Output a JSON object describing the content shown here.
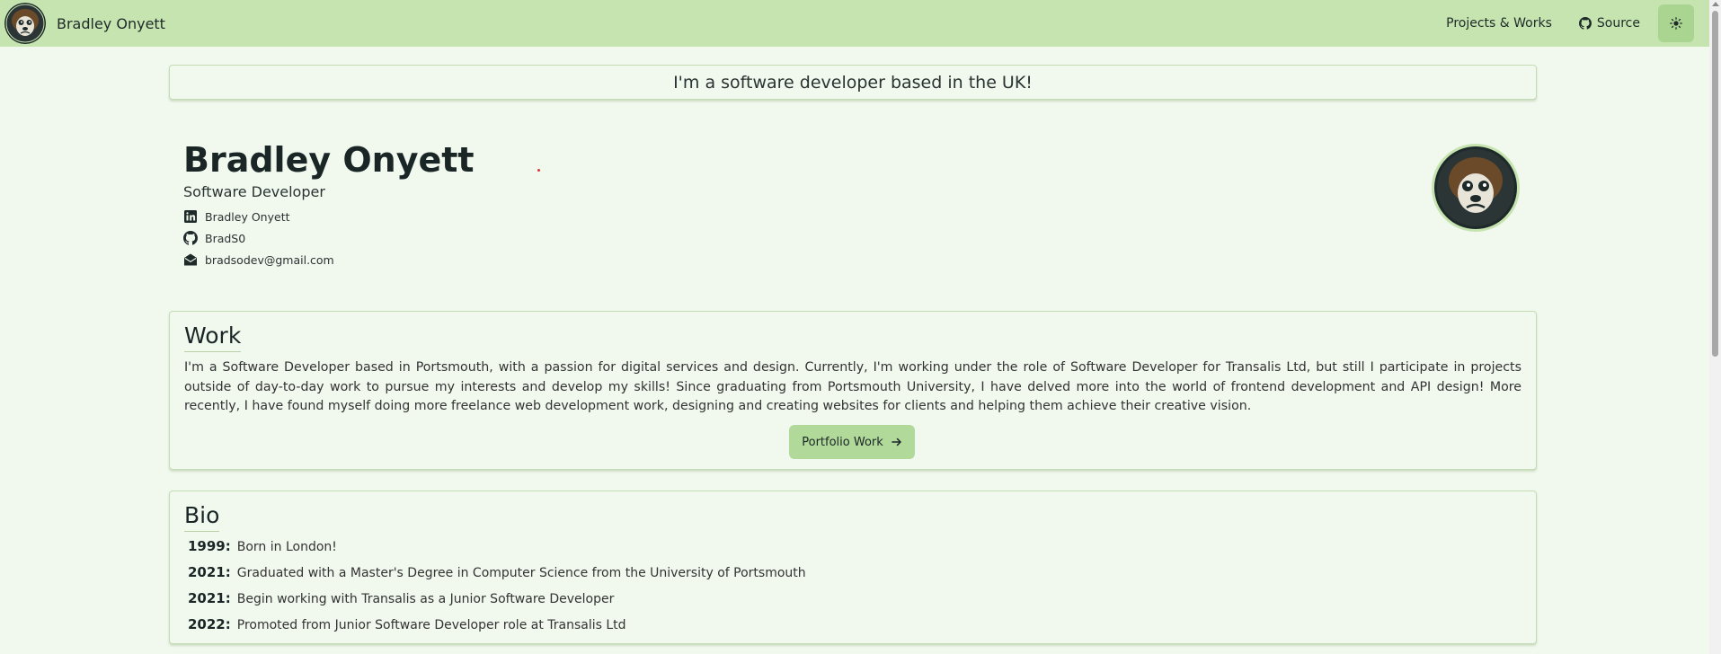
{
  "navbar": {
    "brand": "Bradley Onyett",
    "projects_label": "Projects & Works",
    "source_label": "Source",
    "theme_icon": "sun-icon"
  },
  "tagline": "I'm a software developer based in the UK!",
  "profile": {
    "name": "Bradley Onyett",
    "role": "Software Developer",
    "linkedin": "Bradley Onyett",
    "github": "BradS0",
    "email": "bradsodev@gmail.com"
  },
  "work": {
    "title": "Work",
    "text": "I'm a Software Developer based in Portsmouth, with a passion for digital services and design. Currently, I'm working under the role of Software Developer for Transalis Ltd, but still I participate in projects outside of day-to-day work to pursue my interests and develop my skills! Since graduating from Portsmouth University, I have delved more into the world of frontend development and API design! More recently, I have found myself doing more freelance web development work, designing and creating websites for clients and helping them achieve their creative vision.",
    "button_label": "Portfolio Work"
  },
  "bio": {
    "title": "Bio",
    "items": [
      {
        "year": "1999:",
        "text": "Born in London!"
      },
      {
        "year": "2021:",
        "text": "Graduated with a Master's Degree in Computer Science from the University of Portsmouth"
      },
      {
        "year": "2021:",
        "text": "Begin working with Transalis as a Junior Software Developer"
      },
      {
        "year": "2022:",
        "text": "Promoted from Junior Software Developer role at Transalis Ltd"
      }
    ]
  },
  "colors": {
    "navbar": "#c6e4b0",
    "background": "#f1f8ee",
    "button": "#b1d99a"
  }
}
